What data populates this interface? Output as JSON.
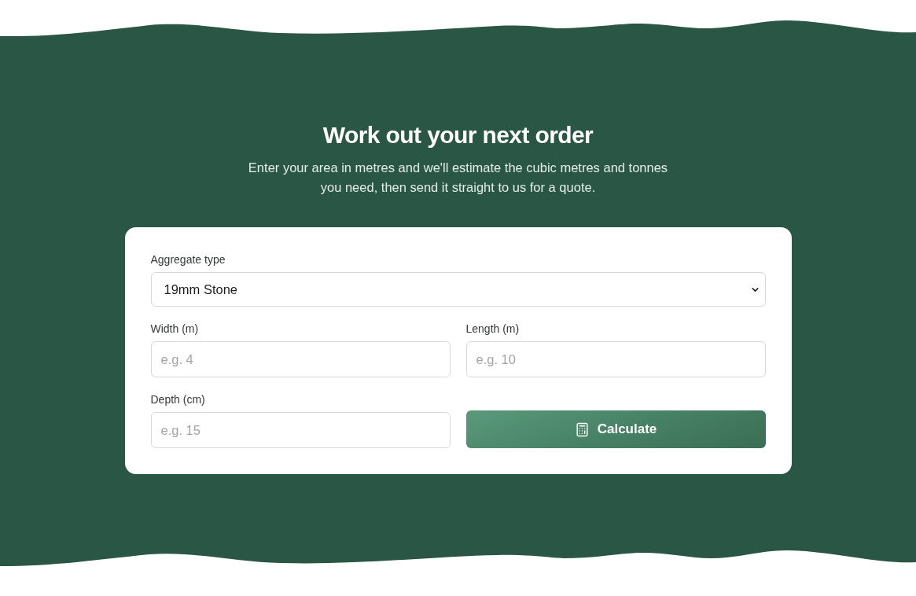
{
  "hero": {
    "title": "Work out your next order",
    "subtitle": "Enter your area in metres and we'll estimate the cubic metres and tonnes you need, then send it straight to us for a quote."
  },
  "form": {
    "aggregate": {
      "label": "Aggregate type",
      "value": "19mm Stone"
    },
    "fields": [
      {
        "label": "Width (m)",
        "placeholder": "e.g. 4"
      },
      {
        "label": "Length (m)",
        "placeholder": "e.g. 10"
      },
      {
        "label": "Depth (cm)",
        "placeholder": "e.g. 15"
      }
    ],
    "button": {
      "label": "Calculate"
    }
  }
}
